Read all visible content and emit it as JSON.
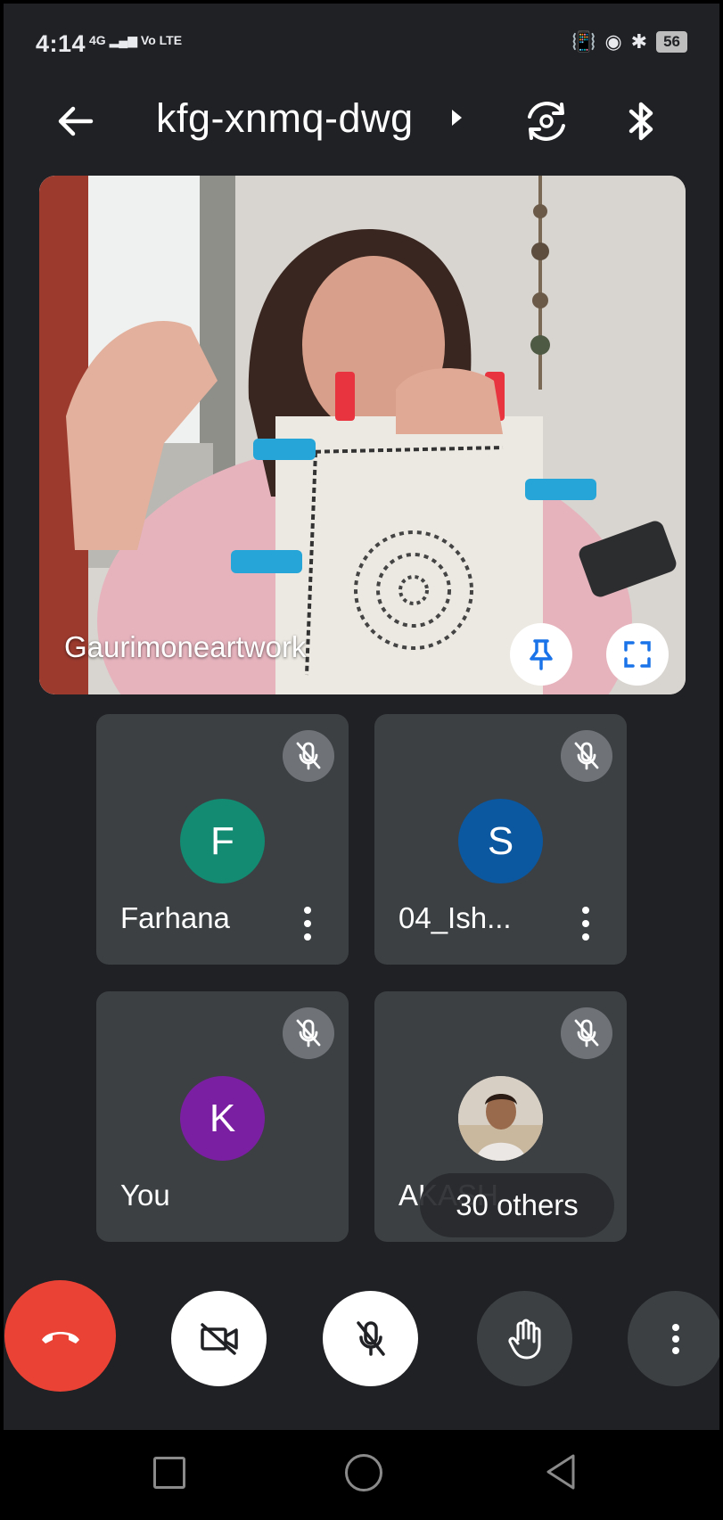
{
  "status_bar": {
    "time": "4:14",
    "network": "4G",
    "network_extra": "Vo LTE",
    "battery": "56"
  },
  "header": {
    "meeting_code": "kfg-xnmq-dwg"
  },
  "main_video": {
    "participant_name": "Gaurimoneartwork"
  },
  "participants": [
    {
      "name": "Farhana",
      "initial": "F",
      "color": "#138a72",
      "muted": true
    },
    {
      "name": "04_Ish...",
      "initial": "S",
      "color": "#0b57a0",
      "muted": true
    },
    {
      "name": "You",
      "initial": "K",
      "color": "#7b1fa2",
      "muted": true
    },
    {
      "name": "AKASH",
      "initial": "",
      "photo": true,
      "muted": true
    }
  ],
  "others_pill": "30 others",
  "controls": {
    "end_call_icon": "end-call-icon",
    "camera_icon": "camera-off-icon",
    "mic_icon": "mic-off-icon",
    "hand_icon": "raise-hand-icon",
    "more_icon": "more-vert-icon"
  },
  "colors": {
    "background": "#202124",
    "tile": "#3c4043",
    "end_call": "#ea4335",
    "accent": "#1a73e8"
  }
}
